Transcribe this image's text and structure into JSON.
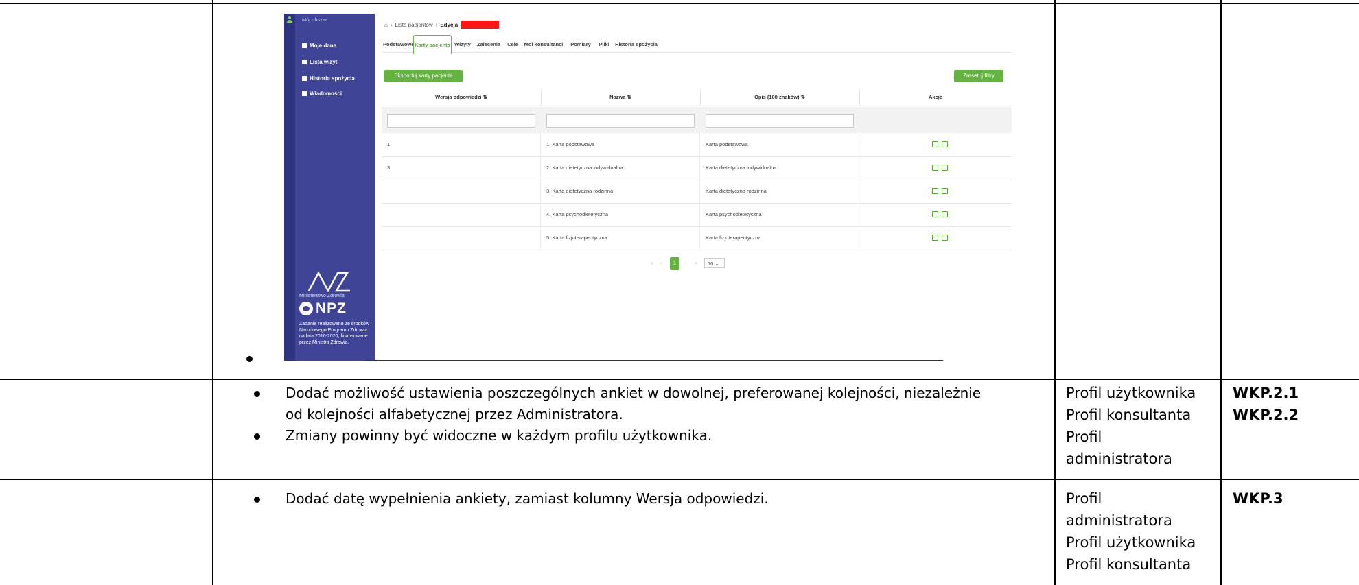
{
  "screenshot": {
    "sidebar": {
      "area_label": "Mój obszar",
      "items": [
        {
          "label": "Moje dane",
          "icon": "id-card-icon"
        },
        {
          "label": "Lista wizyt",
          "icon": "calendar-icon"
        },
        {
          "label": "Historia spożycia",
          "icon": "book-icon"
        },
        {
          "label": "Wiadomości",
          "icon": "mail-icon"
        }
      ],
      "ministry": "Ministerstwo Zdrowia",
      "npz": "NPZ",
      "funding_note": "Zadanie realizowane ze środków Narodowego Programu Zdrowia na lata 2016-2020, finansowane przez Ministra Zdrowia."
    },
    "breadcrumb": {
      "list": "Lista pacjentów",
      "current": "Edycja"
    },
    "tabs": [
      "Podstawowe",
      "Karty pacjenta",
      "Wizyty",
      "Zalecenia",
      "Cele",
      "Moi konsultanci",
      "Pomiary",
      "Pliki",
      "Historia spożycia"
    ],
    "active_tab": "Karty pacjenta",
    "export_button": "Eksportuj karty pacjenta",
    "reset_button": "Zresetuj filtry",
    "columns": [
      "Wersja odpowiedzi ⇅",
      "Nazwa ⇅",
      "Opis (100 znaków) ⇅",
      "Akcje"
    ],
    "rows": [
      {
        "version": "1",
        "name": "1. Karta podstawowa",
        "desc": "Karta podstawowa"
      },
      {
        "version": "3",
        "name": "2. Karta dietetyczna indywidualna",
        "desc": "Karta dietetyczna indywidualna"
      },
      {
        "version": "",
        "name": "3. Karta dietetyczna rodzinna",
        "desc": "Karta dietetyczna rodzinna"
      },
      {
        "version": "",
        "name": "4. Karta psychodietetyczna",
        "desc": "Karta psychodietetyczna"
      },
      {
        "version": "",
        "name": "5. Karta fizjoterapeutyczna",
        "desc": "Karta fizjoterapeutyczna"
      }
    ],
    "pager": {
      "first": "«",
      "prev": "‹",
      "page": "1",
      "next": "›",
      "last": "»",
      "page_size": "10"
    }
  },
  "requirements": [
    {
      "items": [
        "Dodać możliwość ustawienia poszczególnych ankiet w dowolnej, preferowanej kolejności, niezależnie",
        "od kolejności alfabetycznej przez Administratora.",
        "Zmiany powinny być widoczne w każdym profilu użytkownika."
      ],
      "profiles": [
        "Profil użytkownika",
        "Profil konsultanta",
        "Profil",
        "administratora"
      ],
      "codes": [
        "WKP.2.1",
        "WKP.2.2"
      ]
    },
    {
      "items": [
        "Dodać datę wypełnienia ankiety, zamiast kolumny Wersja odpowiedzi."
      ],
      "profiles": [
        "Profil",
        "administratora",
        "Profil użytkownika",
        "Profil konsultanta"
      ],
      "codes": [
        "WKP.3"
      ]
    }
  ]
}
